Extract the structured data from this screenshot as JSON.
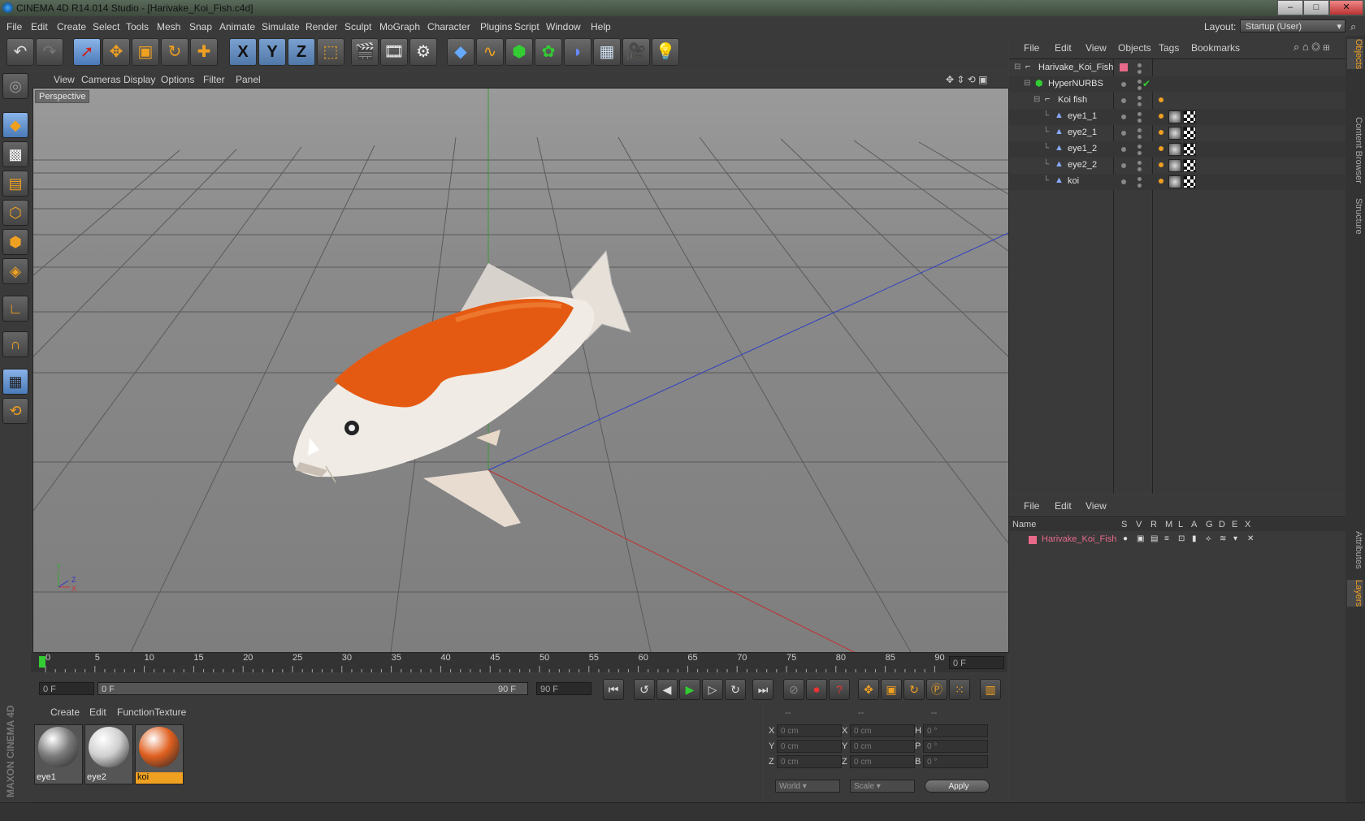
{
  "window": {
    "title": "CINEMA 4D R14.014 Studio - [Harivake_Koi_Fish.c4d]",
    "minimize": "‒",
    "maximize": "□",
    "close": "✕"
  },
  "menu": {
    "items": [
      "File",
      "Edit",
      "Create",
      "Select",
      "Tools",
      "Mesh",
      "Snap",
      "Animate",
      "Simulate",
      "Render",
      "Sculpt",
      "MoGraph",
      "Character",
      "Plugins",
      "Script",
      "Window",
      "Help"
    ]
  },
  "layout": {
    "label": "Layout:",
    "value": "Startup (User)"
  },
  "toolbar": {
    "x": "X",
    "y": "Y",
    "z": "Z"
  },
  "viewport": {
    "menu": [
      "View",
      "Cameras",
      "Display",
      "Options",
      "Filter",
      "Panel"
    ],
    "label": "Perspective",
    "axis_y": "Y",
    "axis_z": "Z",
    "axis_x": "X"
  },
  "timeline": {
    "ticks": [
      "0",
      "5",
      "10",
      "15",
      "20",
      "25",
      "30",
      "35",
      "40",
      "45",
      "50",
      "55",
      "60",
      "65",
      "70",
      "75",
      "80",
      "85",
      "90"
    ],
    "current_frame": "0 F",
    "start": "0 F",
    "range_start": "0 F",
    "range_end": "90 F",
    "end": "90 F"
  },
  "materials": {
    "menu": [
      "Create",
      "Edit",
      "Function",
      "Texture"
    ],
    "items": [
      {
        "name": "eye1",
        "color": "#7a7a7a"
      },
      {
        "name": "eye2",
        "color": "#cfcfcf"
      },
      {
        "name": "koi",
        "color": "#e06020"
      }
    ]
  },
  "coords": {
    "header1": "--",
    "header2": "--",
    "header3": "--",
    "labels1": [
      "X",
      "Y",
      "Z"
    ],
    "labels2": [
      "X",
      "Y",
      "Z"
    ],
    "labels3": [
      "H",
      "P",
      "B"
    ],
    "vals1": [
      "0 cm",
      "0 cm",
      "0 cm"
    ],
    "vals2": [
      "0 cm",
      "0 cm",
      "0 cm"
    ],
    "vals3": [
      "0 °",
      "0 °",
      "0 °"
    ],
    "mode1": "World",
    "mode2": "Scale",
    "apply": "Apply"
  },
  "objects": {
    "menu": [
      "File",
      "Edit",
      "View",
      "Objects",
      "Tags",
      "Bookmarks"
    ],
    "rows": [
      {
        "name": "Harivake_Koi_Fish",
        "indent": 0
      },
      {
        "name": "HyperNURBS",
        "indent": 1
      },
      {
        "name": "Koi fish",
        "indent": 2
      },
      {
        "name": "eye1_1",
        "indent": 3
      },
      {
        "name": "eye2_1",
        "indent": 3
      },
      {
        "name": "eye1_2",
        "indent": 3
      },
      {
        "name": "eye2_2",
        "indent": 3
      },
      {
        "name": "koi",
        "indent": 3
      }
    ]
  },
  "layers": {
    "menu": [
      "File",
      "Edit",
      "View"
    ],
    "columns": [
      "Name",
      "S",
      "V",
      "R",
      "M",
      "L",
      "A",
      "G",
      "D",
      "E",
      "X"
    ],
    "rows": [
      {
        "name": "Harivake_Koi_Fish",
        "color": "#e86a8a"
      }
    ]
  },
  "sidetabs": [
    "Objects",
    "Content Browser",
    "Structure",
    "Attributes",
    "Layers"
  ],
  "brand": "MAXON CINEMA 4D",
  "colors": {
    "accent": "#f0a020",
    "selection": "#f0a020"
  }
}
